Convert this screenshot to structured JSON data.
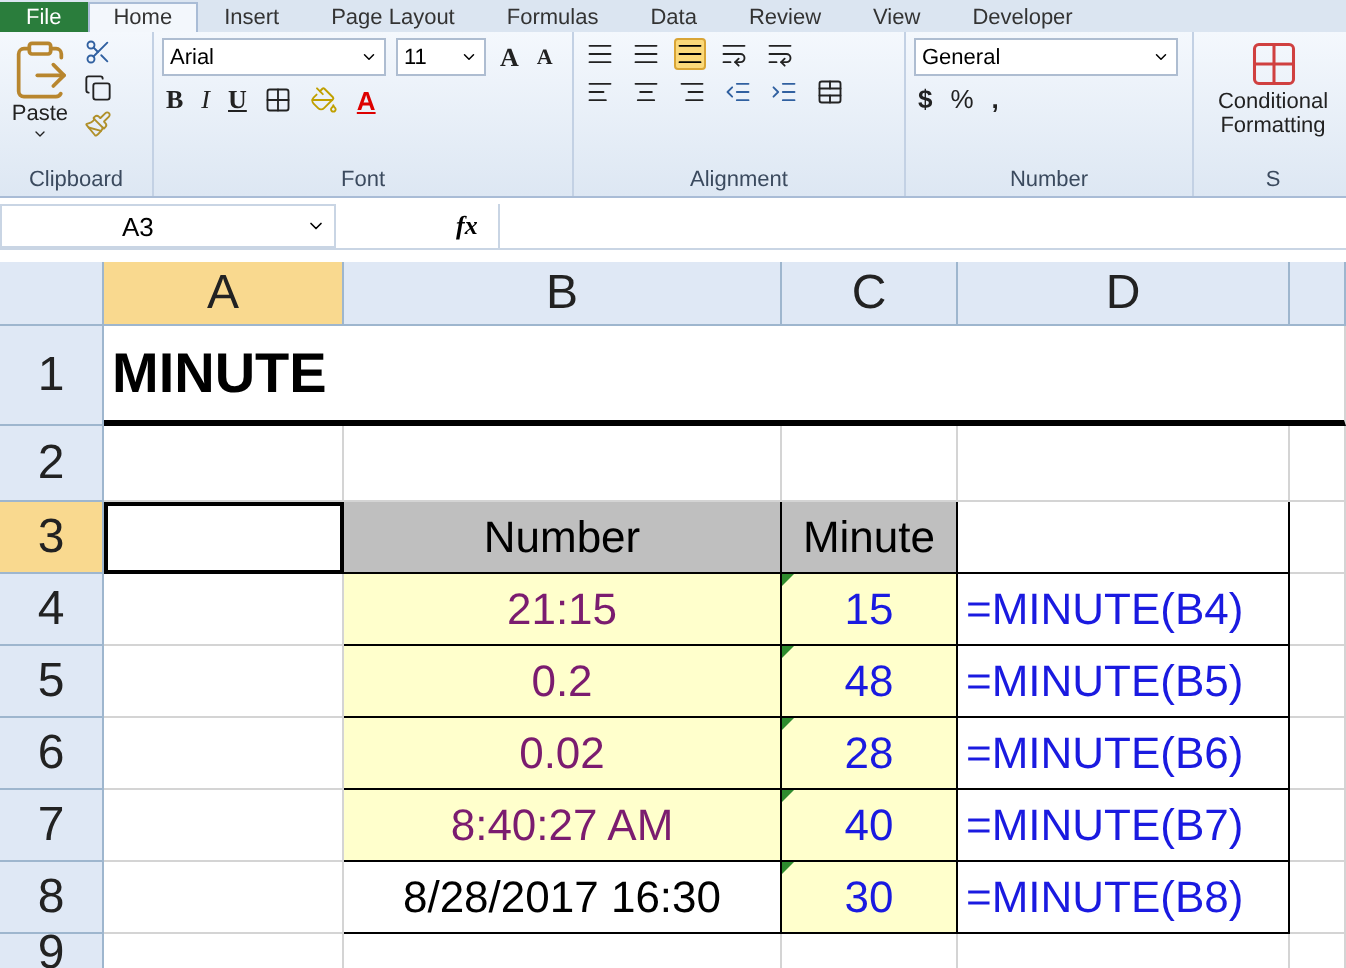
{
  "tabs": [
    {
      "label": "File",
      "selected": false
    },
    {
      "label": "Home",
      "selected": true
    },
    {
      "label": "Insert",
      "selected": false
    },
    {
      "label": "Page Layout",
      "selected": false
    },
    {
      "label": "Formulas",
      "selected": false
    },
    {
      "label": "Data",
      "selected": false
    },
    {
      "label": "Review",
      "selected": false
    },
    {
      "label": "View",
      "selected": false
    },
    {
      "label": "Developer",
      "selected": false
    }
  ],
  "ribbon": {
    "clipboard": {
      "paste": "Paste",
      "label": "Clipboard"
    },
    "font": {
      "name": "Arial",
      "size": "11",
      "grow": "A",
      "shrink": "A",
      "font_color": "A",
      "bold": "B",
      "italic": "I",
      "underline": "U",
      "label": "Font"
    },
    "alignment": {
      "label": "Alignment"
    },
    "number": {
      "format": "General",
      "currency": "$",
      "percent": "%",
      "comma": ",",
      "label": "Number"
    },
    "styles": {
      "button": "Conditional Formatting",
      "label": "S"
    }
  },
  "formula_bar": {
    "name_box": "A3",
    "fx": "fx"
  },
  "columns": [
    {
      "label": "A",
      "selected": true
    },
    {
      "label": "B",
      "selected": false
    },
    {
      "label": "C",
      "selected": false
    },
    {
      "label": "D",
      "selected": false
    }
  ],
  "title": "MINUTE",
  "header": {
    "number": "Number",
    "minute": "Minute"
  },
  "rows": [
    {
      "value": "21:15",
      "color": "#7b1c6f",
      "minute": "15",
      "flagged": true,
      "formula": "=MINUTE(B4)"
    },
    {
      "value": "0.2",
      "color": "#7b1c6f",
      "minute": "48",
      "flagged": true,
      "formula": "=MINUTE(B5)"
    },
    {
      "value": "0.02",
      "color": "#7b1c6f",
      "minute": "28",
      "flagged": true,
      "formula": "=MINUTE(B6)"
    },
    {
      "value": "8:40:27 AM",
      "color": "#7b1c6f",
      "minute": "40",
      "flagged": true,
      "formula": "=MINUTE(B7)"
    },
    {
      "value": "8/28/2017 16:30",
      "color": "#000000",
      "minute": "30",
      "flagged": true,
      "formula": "=MINUTE(B8)"
    }
  ],
  "row_numbers": [
    {
      "label": "1",
      "selected": false
    },
    {
      "label": "2",
      "selected": false
    },
    {
      "label": "3",
      "selected": true
    },
    {
      "label": "4",
      "selected": false
    },
    {
      "label": "5",
      "selected": false
    },
    {
      "label": "6",
      "selected": false
    },
    {
      "label": "7",
      "selected": false
    },
    {
      "label": "8",
      "selected": false
    },
    {
      "label": "9",
      "selected": false
    }
  ]
}
